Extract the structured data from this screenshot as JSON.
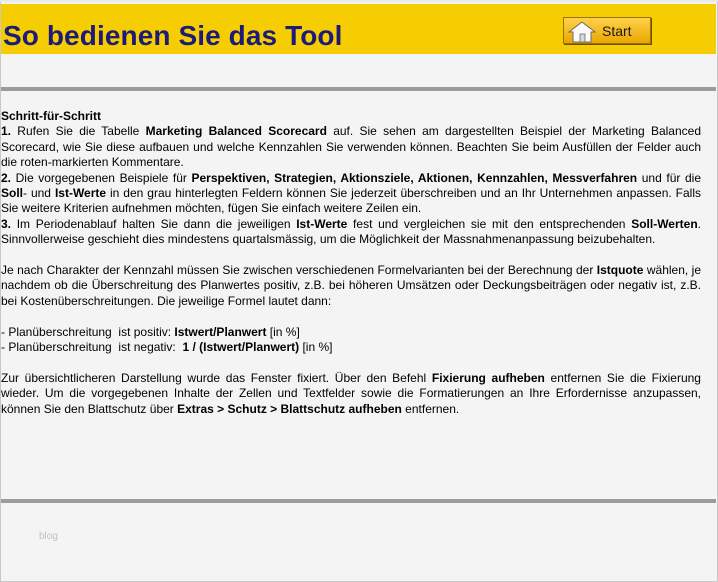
{
  "header": {
    "title": "So bedienen Sie das Tool",
    "start_button": {
      "label": "Start",
      "icon": "house-icon"
    },
    "background_color": "#f6cd00",
    "title_color": "#1c1c78"
  },
  "instructions": {
    "heading": "Schritt-für-Schritt",
    "step1": {
      "num": "1.",
      "t1": " Rufen Sie die Tabelle ",
      "b1": "Marketing Balanced Scorecard",
      "t2": " auf. Sie sehen am dargestellten Beispiel der Marketing Balanced Scorecard, wie Sie diese aufbauen und welche Kennzahlen Sie verwenden können. Beachten Sie beim Ausfüllen der Felder auch die roten-markierten Kommentare."
    },
    "step2": {
      "num": "2.",
      "t1": " Die vorgegebenen Beispiele für ",
      "b1": "Perspektiven, Strategien, Aktionsziele, Aktionen, Kennzahlen, Messverfahren",
      "t2": " und für die ",
      "b2": "Soll",
      "t3": "- und ",
      "b3": "Ist-Werte",
      "t4": " in den grau hinterlegten Feldern können Sie jederzeit überschreiben und an Ihr Unternehmen anpassen. Falls Sie weitere Kriterien aufnehmen möchten, fügen Sie einfach weitere Zeilen ein."
    },
    "step3": {
      "num": "3.",
      "t1": " Im Periodenablauf halten Sie dann die jeweiligen ",
      "b1": "Ist-Werte",
      "t2": " fest und vergleichen sie mit den entsprechenden ",
      "b2": "Soll-Werten",
      "t3": ". Sinnvollerweise geschieht dies mindestens quartalsmässig, um die Möglichkeit der Massnahmenanpassung beizubehalten."
    }
  },
  "formula_info": {
    "t1": "Je nach Charakter der Kennzahl müssen Sie zwischen verschiedenen Formelvarianten bei der Berechnung der ",
    "b1": "Istquote",
    "t2": " wählen, je nachdem ob die Überschreitung des Planwertes positiv, z.B. bei höheren Umsätzen oder Deckungsbeiträgen oder negativ ist, z.B. bei Kostenüberschreitungen. Die jeweilige Formel lautet dann:"
  },
  "formulas": [
    {
      "prefix": "- Planüberschreitung  ist positiv: ",
      "formula": "Istwert/Planwert",
      "suffix": " [in %]"
    },
    {
      "prefix": "- Planüberschreitung  ist negativ:  ",
      "formula": "1 / (Istwert/Planwert)",
      "suffix": " [in %]"
    }
  ],
  "fixation_info": {
    "t1": "Zur übersichtlicheren Darstellung wurde das Fenster fixiert. Über den Befehl ",
    "b1": "Fixierung aufheben",
    "t2": " entfernen Sie die Fixierung wieder. Um die vorgegebenen Inhalte der Zellen und Textfelder sowie die Formatierungen an Ihre Erfordernisse anzupassen, können Sie den Blattschutz über ",
    "b2": "Extras > Schutz >  Blattschutz  aufheben",
    "t3": " entfernen."
  },
  "watermark": "blog"
}
